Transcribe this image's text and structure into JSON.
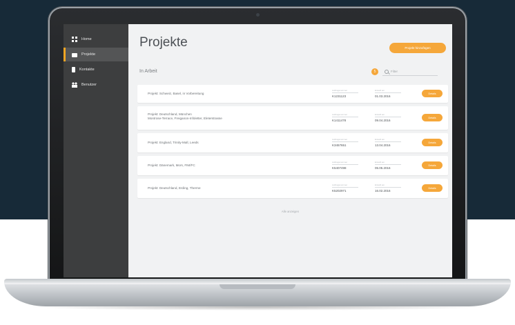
{
  "sidebar": {
    "items": [
      {
        "label": "Home",
        "icon": "grid-icon",
        "active": false
      },
      {
        "label": "Projekte",
        "icon": "folder-icon",
        "active": true
      },
      {
        "label": "Kontakte",
        "icon": "phone-icon",
        "active": false
      },
      {
        "label": "Benutzer",
        "icon": "people-icon",
        "active": false
      }
    ]
  },
  "main": {
    "title": "Projekte",
    "top_button_label": "Projekt hinzufügen",
    "section_label": "In Arbeit",
    "count": "5",
    "search_placeholder": "Filter",
    "show_all_label": "Alle anzeigen"
  },
  "rows": [
    {
      "title": "Projekt: Schweiz, Basel, in Vorbereitung",
      "subtitle": "",
      "number_label": "Auftragsnummer",
      "number": "K1231123",
      "date_label": "Erstellt am",
      "date": "01.03.2016",
      "button": "Details"
    },
    {
      "title": "Projekt: Deutschland, München",
      "subtitle": "Montrose-Terrace, Freiganon-Infoletter, Eleterstrasse",
      "number_label": "Auftragsnummer",
      "number": "K1411478",
      "date_label": "Erstellt am",
      "date": "09.04.2016",
      "button": "Details"
    },
    {
      "title": "Projekt: England, Trinity-Mall, Leeds",
      "subtitle": "",
      "number_label": "Auftragsnummer",
      "number": "K3457651",
      "date_label": "Erstellt am",
      "date": "13.04.2016",
      "button": "Details"
    },
    {
      "title": "Projekt: Dänemark, Mors, FIM/FC",
      "subtitle": "",
      "number_label": "Auftragsnummer",
      "number": "K5407498",
      "date_label": "Erstellt am",
      "date": "05.05.2016",
      "button": "Details"
    },
    {
      "title": "Projekt: Deutschland, Erding, Therme",
      "subtitle": "",
      "number_label": "Auftragsnummer",
      "number": "K5202971",
      "date_label": "Erstellt am",
      "date": "16.02.2016",
      "button": "Details"
    }
  ],
  "colors": {
    "accent": "#f5a73a",
    "sidebar": "#3d3e3f",
    "background": "#172a38"
  }
}
